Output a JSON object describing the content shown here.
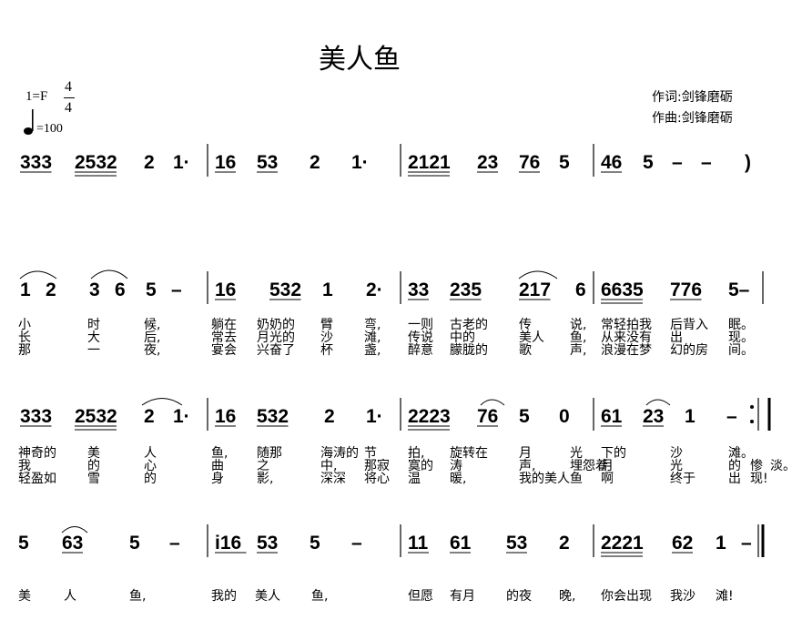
{
  "title": "美人鱼",
  "key": "1=F",
  "time_signature": {
    "numerator": "4",
    "denominator": "4"
  },
  "tempo": "=100",
  "lyricist": "作词:剑锋磨砺",
  "composer": "作曲:剑锋磨砺",
  "row1_notes": [
    "333",
    "2532",
    "2",
    "1·",
    "16",
    "53",
    "2",
    "1·",
    "2121",
    "23",
    "76",
    "5",
    "46",
    "5",
    "–",
    "–",
    ")"
  ],
  "row2_notes": [
    "1",
    "2",
    "3",
    "6",
    "5",
    "–",
    "16",
    "532",
    "1",
    "2·",
    "33",
    "235",
    "217",
    "6",
    "6635",
    "776",
    "5–"
  ],
  "row2_lyrics": [
    [
      "小",
      "时",
      "候,",
      "躺在",
      "奶奶的",
      "臂",
      "弯,",
      "一则",
      "古老的",
      "传",
      "说,",
      "常轻拍我",
      "后背入",
      "眠。"
    ],
    [
      "长",
      "大",
      "后,",
      "常去",
      "月光的",
      "沙",
      "滩,",
      "传说",
      "中的",
      "美人",
      "鱼,",
      "从来没有",
      "出",
      "现。"
    ],
    [
      "那",
      "一",
      "夜,",
      "宴会",
      "兴奋了",
      "杯",
      "盏,",
      "醉意",
      "朦胧的",
      "歌",
      "声,",
      "浪漫在梦",
      "幻的房",
      "间。"
    ]
  ],
  "row3_notes": [
    "333",
    "2532",
    "2",
    "1·",
    "16",
    "532",
    "2",
    "1·",
    "2223",
    "76",
    "5",
    "0",
    "61",
    "23",
    "1",
    "–"
  ],
  "row3_lyrics": [
    [
      "神奇的",
      "美",
      "人",
      "鱼,",
      "随那",
      "海涛的",
      "节",
      "拍,",
      "旋转在",
      "月",
      "光",
      "下的",
      "沙",
      "滩。"
    ],
    [
      "我",
      "的",
      "心",
      "曲",
      "之",
      "中,",
      "那寂",
      "寞的",
      "涛",
      "声,",
      "埋怨着",
      "月",
      "光",
      "的",
      "惨",
      "淡。"
    ],
    [
      "轻盈如",
      "雪",
      "的",
      "身",
      "影,",
      "深深",
      "将心",
      "温",
      "暖,",
      "我的美人",
      "鱼",
      "啊",
      "终于",
      "出",
      "现!"
    ]
  ],
  "row4_notes": [
    "5",
    "63",
    "5",
    "–",
    "i16",
    "53",
    "5",
    "–",
    "11",
    "61",
    "53",
    "2",
    "2221",
    "62",
    "1",
    "–"
  ],
  "row4_lyrics": [
    "美",
    "人",
    "鱼,",
    "我的",
    "美人",
    "鱼,",
    "但愿",
    "有月",
    "的夜",
    "晚,",
    "你会出现",
    "我沙",
    "滩!"
  ]
}
